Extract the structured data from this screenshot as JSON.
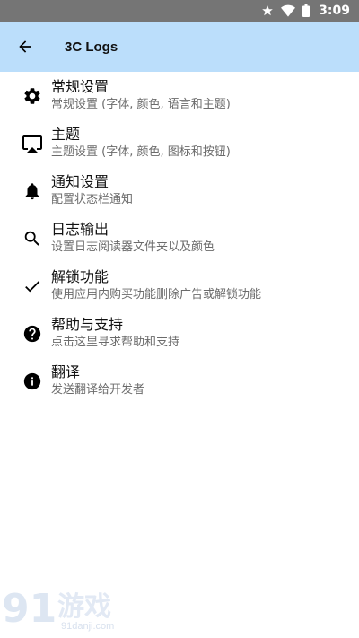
{
  "status_bar": {
    "time": "3:09",
    "icons": [
      "star-icon",
      "wifi-icon",
      "battery-icon"
    ]
  },
  "app_bar": {
    "title": "3C Logs",
    "back_icon": "arrow-left-icon"
  },
  "settings": [
    {
      "title": "常规设置",
      "subtitle": "常规设置 (字体, 颜色, 语言和主题)",
      "icon": "gear-icon"
    },
    {
      "title": "主题",
      "subtitle": "主题设置 (字体, 颜色, 图标和按钮)",
      "icon": "cast-icon"
    },
    {
      "title": "通知设置",
      "subtitle": "配置状态栏通知",
      "icon": "bell-icon"
    },
    {
      "title": "日志输出",
      "subtitle": "设置日志阅读器文件夹以及颜色",
      "icon": "search-icon"
    },
    {
      "title": "解锁功能",
      "subtitle": "使用应用内购买功能删除广告或解锁功能",
      "icon": "check-icon"
    },
    {
      "title": "帮助与支持",
      "subtitle": "点击这里寻求帮助和支持",
      "icon": "help-icon"
    },
    {
      "title": "翻译",
      "subtitle": "发送翻译给开发者",
      "icon": "info-icon"
    }
  ],
  "watermark": {
    "number": "91",
    "text": "游戏",
    "site": "91danji.com"
  },
  "colors": {
    "app_bar": "#bbdefb",
    "status_bar": "#757575",
    "icon": "#000000",
    "subtitle": "#6b6b6b"
  }
}
